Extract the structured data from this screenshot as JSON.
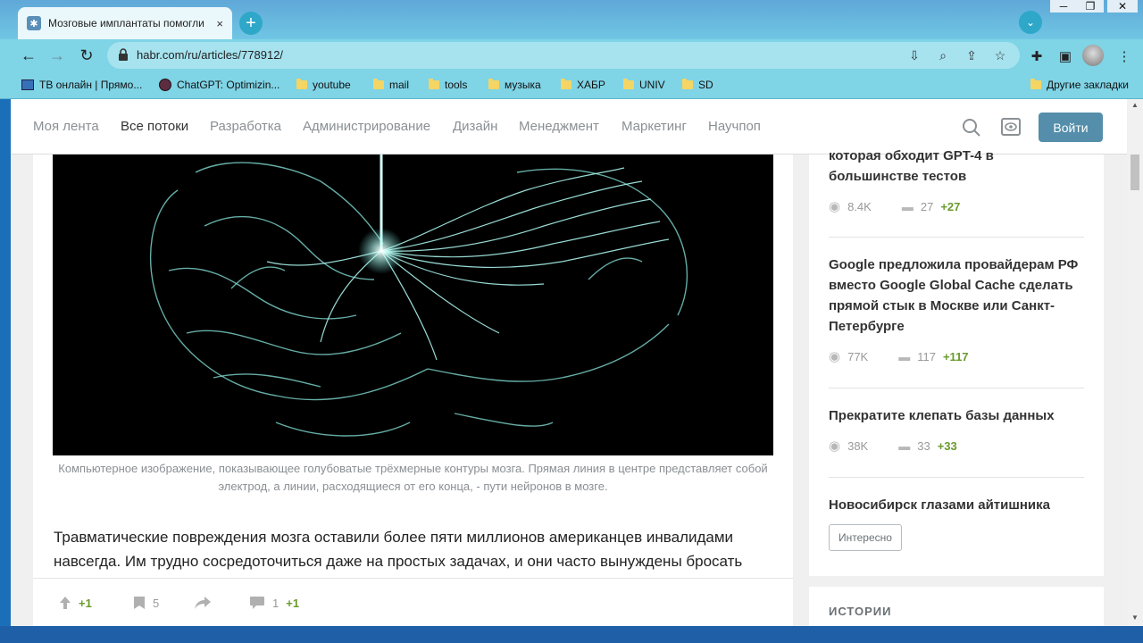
{
  "browser": {
    "tab_title": "Мозговые имплантаты помогли",
    "tab_close": "×",
    "new_tab": "+",
    "tab_menu": "⌄",
    "window_controls": [
      "─",
      "❐",
      "✕"
    ],
    "url": "habr.com/ru/articles/778912/"
  },
  "bookmarks": [
    {
      "label": "ТВ онлайн | Прямо...",
      "icon": "tv-icon"
    },
    {
      "label": "ChatGPT: Optimizin...",
      "icon": "chatgpt-icon"
    },
    {
      "label": "youtube",
      "icon": "folder-icon"
    },
    {
      "label": "mail",
      "icon": "folder-icon"
    },
    {
      "label": "tools",
      "icon": "folder-icon"
    },
    {
      "label": "музыка",
      "icon": "folder-icon"
    },
    {
      "label": "ХАБР",
      "icon": "folder-icon"
    },
    {
      "label": "UNIV",
      "icon": "folder-icon"
    },
    {
      "label": "SD",
      "icon": "folder-icon"
    }
  ],
  "other_bookmarks": "Другие закладки",
  "nav": {
    "items": [
      "Моя лента",
      "Все потоки",
      "Разработка",
      "Администрирование",
      "Дизайн",
      "Менеджмент",
      "Маркетинг",
      "Научпоп"
    ],
    "active": "Все потоки",
    "login": "Войти"
  },
  "article": {
    "caption": "Компьютерное изображение, показывающее голубоватые трёхмерные контуры мозга. Прямая линия в центре представляет собой электрод, а линии, расходящиеся от его конца, - пути нейронов в мозге.",
    "lead": "Травматические повреждения мозга оставили более пяти миллионов американцев инвалидами навсегда. Им трудно сосредоточиться даже на простых задачах, и они часто вынуждены бросать"
  },
  "actions": {
    "votes": "+1",
    "bookmarks": "5",
    "comments": "1",
    "comments_delta": "+1"
  },
  "sidebar": {
    "posts": [
      {
        "title": "которая обходит GPT-4 в большинстве тестов",
        "views": "8.4K",
        "comments": "27",
        "delta": "+27"
      },
      {
        "title": "Google предложила провайдерам РФ вместо Google Global Cache сделать прямой стык в Москве или Санкт-Петербурге",
        "views": "77K",
        "comments": "117",
        "delta": "+117"
      },
      {
        "title": "Прекратите клепать базы данных",
        "views": "38K",
        "comments": "33",
        "delta": "+33"
      },
      {
        "title": "Новосибирск глазами айтишника"
      }
    ],
    "tag_button": "Интересно",
    "stories": "ИСТОРИИ"
  }
}
